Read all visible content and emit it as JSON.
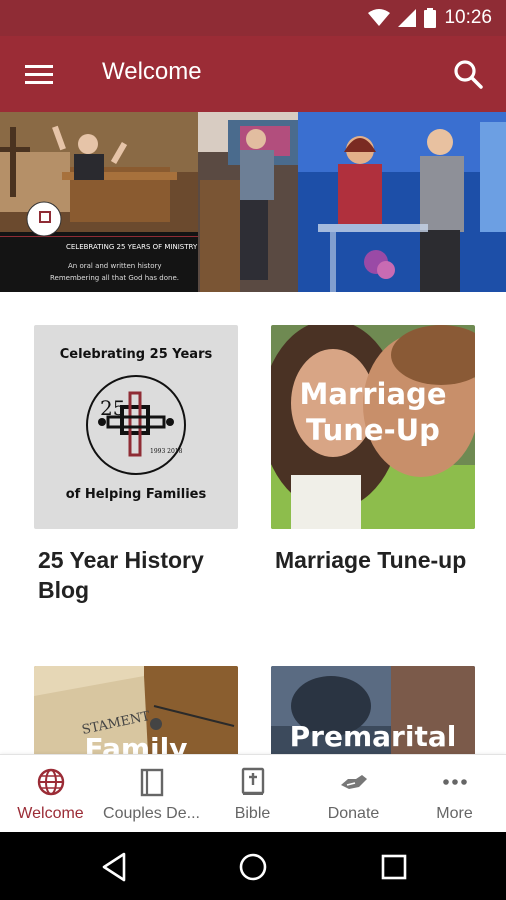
{
  "status_bar": {
    "time": "10:26"
  },
  "app_bar": {
    "title": "Welcome"
  },
  "hero": {
    "banner_line1": "CELEBRATING 25 YEARS OF MINISTRY",
    "banner_line2": "An oral and written history",
    "banner_line3": "Remembering all that God has done."
  },
  "cards": [
    {
      "label": "25 Year History Blog",
      "thumb_top": "Celebrating 25 Years",
      "thumb_bottom": "of Helping Families",
      "logo_number": "25",
      "logo_years": "1993 2018"
    },
    {
      "label": "Marriage Tune-up",
      "thumb_text_1": "Marriage",
      "thumb_text_2": "Tune-Up"
    },
    {
      "label": "",
      "thumb_text_1": "Family",
      "thumb_text_2": "STAMENT"
    },
    {
      "label": "",
      "thumb_text_1": "Premarital"
    }
  ],
  "bottom_nav": [
    {
      "label": "Welcome",
      "icon": "globe-icon",
      "active": true
    },
    {
      "label": "Couples De...",
      "icon": "book-outline-icon"
    },
    {
      "label": "Bible",
      "icon": "bible-icon"
    },
    {
      "label": "Donate",
      "icon": "handshake-icon"
    },
    {
      "label": "More",
      "icon": "more-dots-icon"
    }
  ],
  "colors": {
    "primary": "#9b2c36",
    "status": "#8f2c35"
  }
}
